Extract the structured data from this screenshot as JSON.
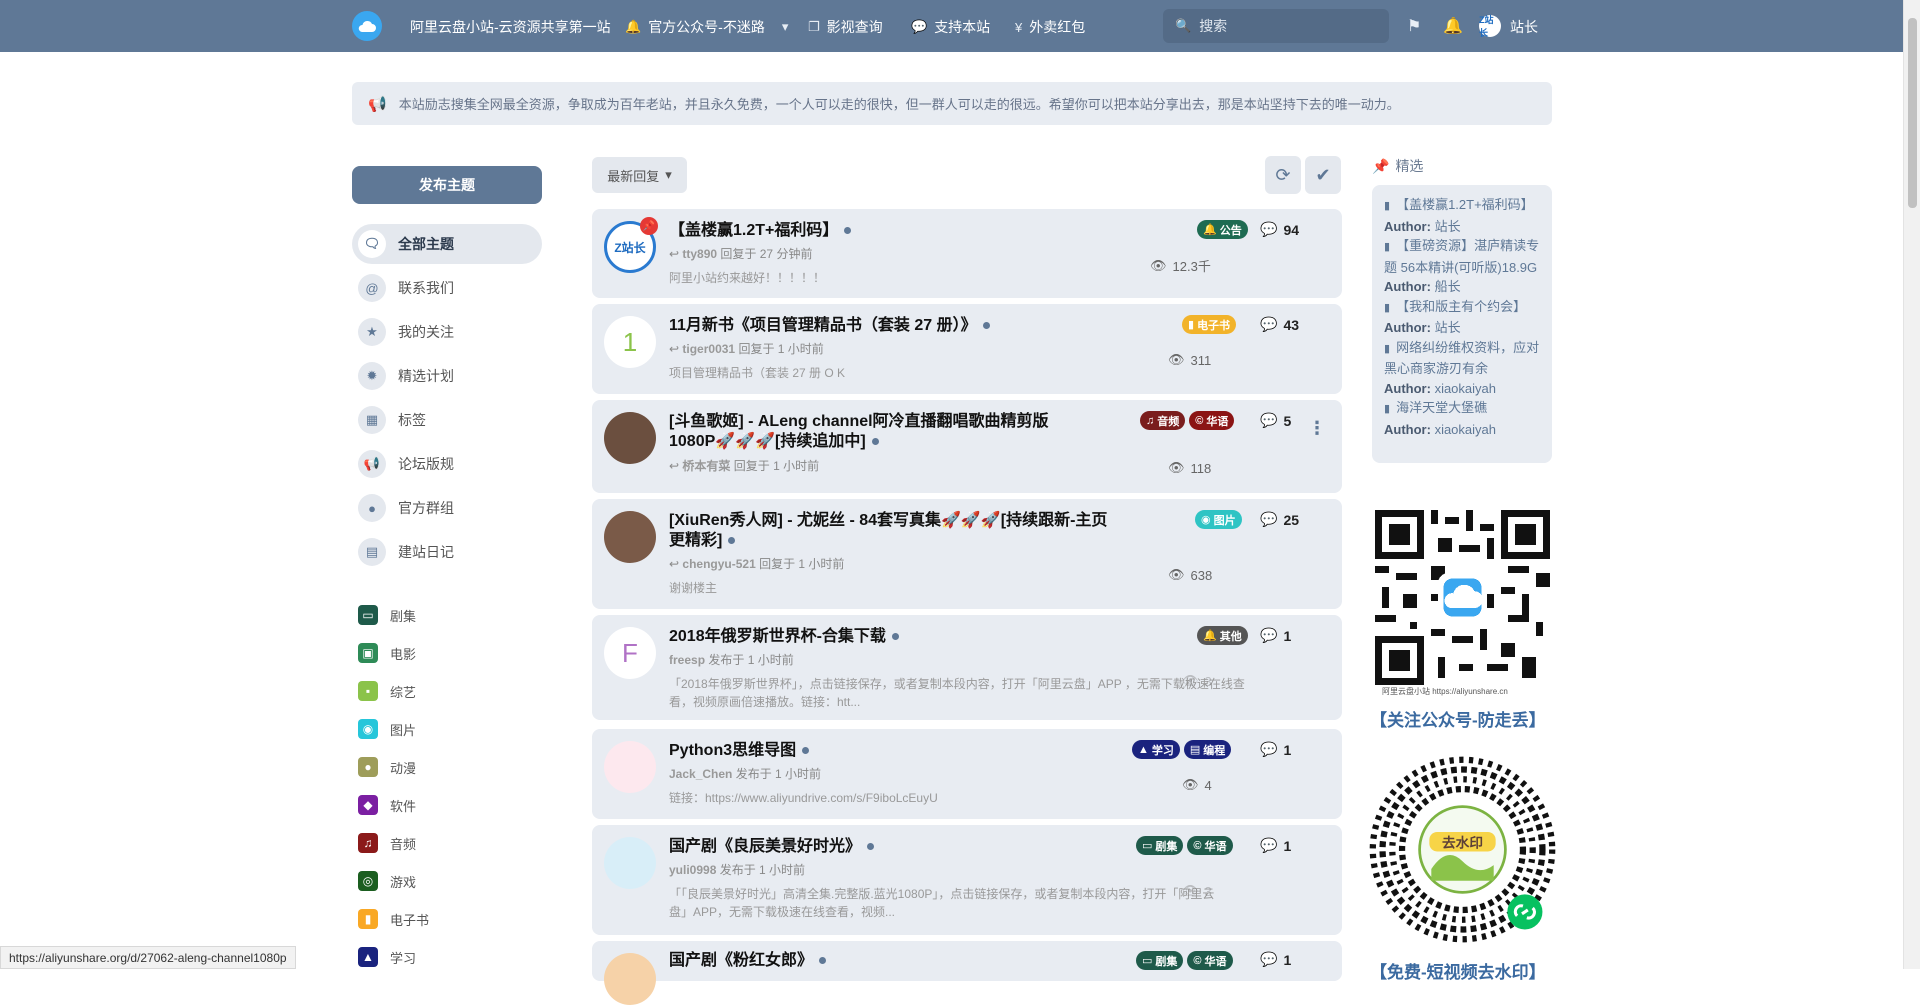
{
  "header": {
    "site_title": "阿里云盘小站-云资源共享第一站",
    "nav": [
      {
        "label": "官方公众号-不迷路",
        "icon": "bell-icon"
      },
      {
        "label": "影视查询",
        "icon": "copy-icon"
      },
      {
        "label": "支持本站",
        "icon": "chat-icon"
      },
      {
        "label": "外卖红包",
        "icon": "yen-icon"
      }
    ],
    "search_placeholder": "搜索",
    "avatar_text": "Z站长",
    "username": "站长"
  },
  "notice": "本站励志搜集全网最全资源，争取成为百年老站，并且永久免费，一个人可以走的很快，但一群人可以走的很远。希望你可以把本站分享出去，那是本站坚持下去的唯一动力。",
  "sidebar": {
    "post_button": "发布主题",
    "items": [
      {
        "label": "全部主题",
        "icon": "comments-icon"
      },
      {
        "label": "联系我们",
        "icon": "at-icon"
      },
      {
        "label": "我的关注",
        "icon": "star-icon"
      },
      {
        "label": "精选计划",
        "icon": "badge-icon"
      },
      {
        "label": "标签",
        "icon": "grid-icon"
      },
      {
        "label": "论坛版规",
        "icon": "megaphone-icon"
      },
      {
        "label": "官方群组",
        "icon": "chat-icon"
      },
      {
        "label": "建站日记",
        "icon": "calendar-icon"
      }
    ],
    "tags": [
      {
        "label": "剧集",
        "color": "#1e5a4a"
      },
      {
        "label": "电影",
        "color": "#2e8b57"
      },
      {
        "label": "综艺",
        "color": "#8bc34a"
      },
      {
        "label": "图片",
        "color": "#26c6da"
      },
      {
        "label": "动漫",
        "color": "#9e9d5a"
      },
      {
        "label": "软件",
        "color": "#7b1fa2"
      },
      {
        "label": "音频",
        "color": "#8b1a1a"
      },
      {
        "label": "游戏",
        "color": "#1b5e20"
      },
      {
        "label": "电子书",
        "color": "#f9a825"
      },
      {
        "label": "学习",
        "color": "#1a237e"
      }
    ]
  },
  "toolbar": {
    "sort_label": "最新回复"
  },
  "discussions": [
    {
      "title": "【盖楼赢1.2T+福利码】",
      "author": "tty890",
      "action": "回复于 27 分钟前",
      "excerpt": "阿里小站约来越好！！！！！",
      "tags": [
        {
          "label": "公告",
          "color": "#1e6b52"
        }
      ],
      "replies": "94",
      "views": "12.3千",
      "avatar": "Z站长"
    },
    {
      "title": "11月新书《项目管理精品书（套装 27 册）》",
      "author": "tiger0031",
      "action": "回复于 1 小时前",
      "excerpt": "项目管理精品书（套装 27 册 O K",
      "tags": [
        {
          "label": "电子书",
          "color": "#f2b32a"
        }
      ],
      "replies": "43",
      "views": "311",
      "avatar": "1"
    },
    {
      "title": "[斗鱼歌姬] - ALeng channel阿冷直播翻唱歌曲精剪版1080P🚀🚀🚀[持续追加中]",
      "author": "桥本有菜",
      "action": "回复于 1 小时前",
      "excerpt": "",
      "tags": [
        {
          "label": "音频",
          "color": "#7a1d1d"
        },
        {
          "label": "华语",
          "color": "#8b1414"
        }
      ],
      "replies": "5",
      "views": "118",
      "avatar": ""
    },
    {
      "title": "[XiuRen秀人网] - 尤妮丝 - 84套写真集🚀🚀🚀[持续跟新-主页更精彩]",
      "author": "chengyu-521",
      "action": "回复于 1 小时前",
      "excerpt": "谢谢楼主",
      "tags": [
        {
          "label": "图片",
          "color": "#2ec4c4"
        }
      ],
      "replies": "25",
      "views": "638",
      "avatar": ""
    },
    {
      "title": "2018年俄罗斯世界杯-合集下载",
      "author": "freesp",
      "action": "发布于 1 小时前",
      "excerpt": "「2018年俄罗斯世界杯」，点击链接保存，或者复制本段内容，打开「阿里云盘」APP ，无需下载极速在线查看，视频原画倍速播放。链接：htt...",
      "tags": [
        {
          "label": "其他",
          "color": "#555555"
        }
      ],
      "replies": "1",
      "views": "3",
      "avatar": "F"
    },
    {
      "title": "Python3思维导图",
      "author": "Jack_Chen",
      "action": "发布于 1 小时前",
      "excerpt": "链接：https://www.aliyundrive.com/s/F9iboLcEuyU",
      "tags": [
        {
          "label": "学习",
          "color": "#1a237e"
        },
        {
          "label": "编程",
          "color": "#1a237e"
        }
      ],
      "replies": "1",
      "views": "4",
      "avatar": ""
    },
    {
      "title": "国产剧《良辰美景好时光》",
      "author": "yuli0998",
      "action": "发布于 1 小时前",
      "excerpt": "「「良辰美景好时光」高清全集.完整版.蓝光1080P」，点击链接保存，或者复制本段内容，打开「阿里云盘」APP，无需下载极速在线查看，视频...",
      "tags": [
        {
          "label": "剧集",
          "color": "#1e5a4a"
        },
        {
          "label": "华语",
          "color": "#1e5a4a"
        }
      ],
      "replies": "1",
      "views": "3",
      "avatar": ""
    },
    {
      "title": "国产剧《粉红女郎》",
      "author": "",
      "action": "",
      "excerpt": "",
      "tags": [
        {
          "label": "剧集",
          "color": "#1e5a4a"
        },
        {
          "label": "华语",
          "color": "#1e5a4a"
        }
      ],
      "replies": "1",
      "views": "",
      "avatar": ""
    }
  ],
  "featured": {
    "heading": "精选",
    "items": [
      {
        "title": "【盖楼赢1.2T+福利码】",
        "author_label": "Author:",
        "author": "站长"
      },
      {
        "title": "【重磅资源】湛庐精读专题 56本精讲(可听版)18.9G",
        "author_label": "Author:",
        "author": "船长"
      },
      {
        "title": "【我和版主有个约会】",
        "author_label": "Author:",
        "author": "站长"
      },
      {
        "title": "网络纠纷维权资料，应对黑心商家游刃有余",
        "author_label": "Author:",
        "author": "xiaokaiyah"
      },
      {
        "title": "海洋天堂大堡礁",
        "author_label": "Author:",
        "author": "xiaokaiyah"
      }
    ],
    "qr1_caption": "阿里云盘小站    https://aliyunshare.cn",
    "qr1_title": "【关注公众号-防走丢】",
    "qr2_title": "【免费-短视频去水印】",
    "qr2_badge": "去水印"
  },
  "statusbar": "https://aliyunshare.org/d/27062-aleng-channel1080p"
}
